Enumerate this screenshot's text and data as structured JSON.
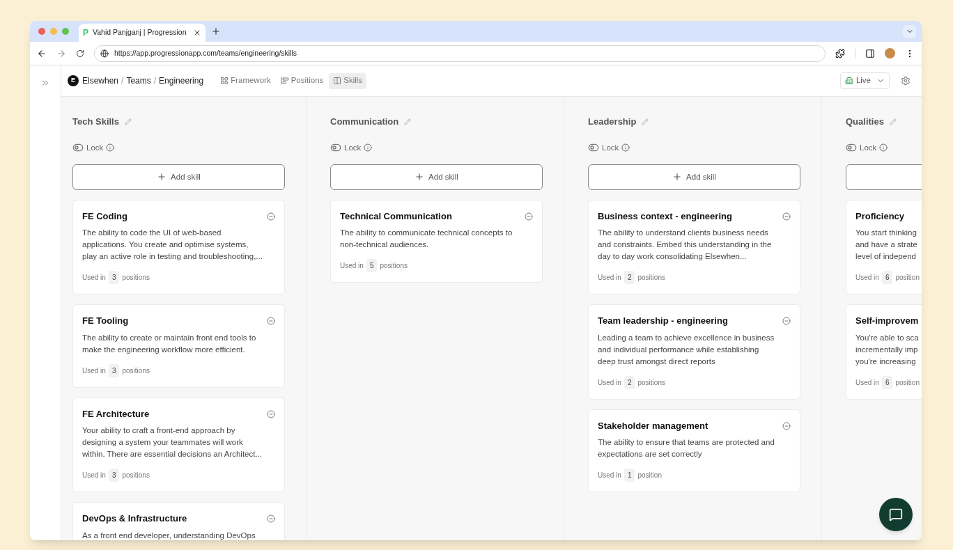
{
  "browser": {
    "tab_title": "Vahid Panjganj | Progression",
    "tab_logo": "P",
    "url": "https://app.progressionapp.com/teams/engineering/skills"
  },
  "header": {
    "org_initial": "E",
    "breadcrumb": [
      "Elsewhen",
      "Teams",
      "Engineering"
    ],
    "separator": "/",
    "nav": [
      {
        "label": "Framework",
        "kind": "framework",
        "selected": false
      },
      {
        "label": "Positions",
        "kind": "positions",
        "selected": false
      },
      {
        "label": "Skills",
        "kind": "skills",
        "selected": true
      }
    ],
    "status": "Live"
  },
  "columns": [
    {
      "title": "Tech Skills",
      "lock_label": "Lock",
      "add_label": "Add skill",
      "skills": [
        {
          "title": "FE Coding",
          "description": "The ability to code the UI of web-based\napplications. You create and optimise systems,\nplay an active role in testing and troubleshooting,...",
          "used_prefix": "Used in",
          "count": "3",
          "used_suffix": "positions"
        },
        {
          "title": "FE Tooling",
          "description": "The ability to create or maintain front end tools to\nmake the engineering workflow more efficient.",
          "used_prefix": "Used in",
          "count": "3",
          "used_suffix": "positions"
        },
        {
          "title": "FE Architecture",
          "description": "Your ability to craft a front-end approach by\ndesigning a system your teammates will work\nwithin. There are essential decisions an Architect...",
          "used_prefix": "Used in",
          "count": "3",
          "used_suffix": "positions"
        },
        {
          "title": "DevOps & Infrastructure",
          "description": "As a front end developer, understanding DevOps"
        }
      ]
    },
    {
      "title": "Communication",
      "lock_label": "Lock",
      "add_label": "Add skill",
      "skills": [
        {
          "title": "Technical Communication",
          "description": "The ability to communicate technical concepts to\nnon-technical audiences.",
          "used_prefix": "Used in",
          "count": "5",
          "used_suffix": "positions"
        }
      ]
    },
    {
      "title": "Leadership",
      "lock_label": "Lock",
      "add_label": "Add skill",
      "skills": [
        {
          "title": "Business context - engineering",
          "description": "The ability to understand clients business needs\nand constraints. Embed this understanding in the\nday to day work consolidating Elsewhen...",
          "used_prefix": "Used in",
          "count": "2",
          "used_suffix": "positions"
        },
        {
          "title": "Team leadership - engineering",
          "description": "Leading a team to achieve excellence in business\nand individual performance while establishing\ndeep trust amongst direct reports",
          "used_prefix": "Used in",
          "count": "2",
          "used_suffix": "positions"
        },
        {
          "title": "Stakeholder management",
          "description": "The ability to ensure that teams are protected and\nexpectations are set correctly",
          "used_prefix": "Used in",
          "count": "1",
          "used_suffix": "position"
        }
      ]
    },
    {
      "title": "Qualities",
      "lock_label": "Lock",
      "skills": [
        {
          "title": "Proficiency",
          "description": "You start thinking\nand have a strate\nlevel of independ",
          "used_prefix": "Used in",
          "count": "6",
          "used_suffix": "position"
        },
        {
          "title": "Self-improvem",
          "description": "You're able to sca\nincrementally imp\nyou're increasing",
          "used_prefix": "Used in",
          "count": "6",
          "used_suffix": "position"
        }
      ]
    }
  ]
}
